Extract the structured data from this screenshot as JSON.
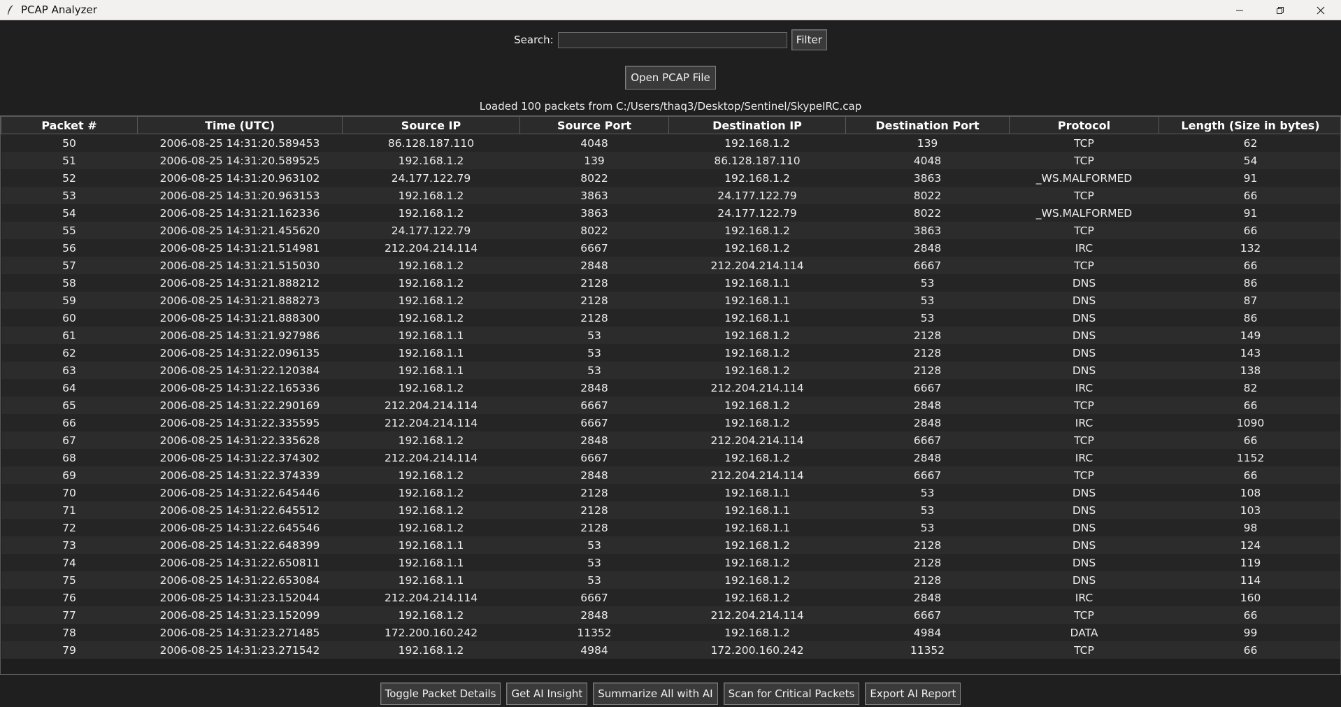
{
  "window": {
    "title": "PCAP Analyzer",
    "icon": "feather-icon"
  },
  "search": {
    "label": "Search:",
    "value": "",
    "placeholder": "",
    "filter_label": "Filter"
  },
  "open_button_label": "Open PCAP File",
  "status": "Loaded 100 packets from C:/Users/thaq3/Desktop/Sentinel/SkypeIRC.cap",
  "table": {
    "columns": [
      "Packet #",
      "Time (UTC)",
      "Source IP",
      "Source Port",
      "Destination IP",
      "Destination Port",
      "Protocol",
      "Length (Size in bytes)"
    ],
    "rows": [
      [
        "50",
        "2006-08-25 14:31:20.589453",
        "86.128.187.110",
        "4048",
        "192.168.1.2",
        "139",
        "TCP",
        "62"
      ],
      [
        "51",
        "2006-08-25 14:31:20.589525",
        "192.168.1.2",
        "139",
        "86.128.187.110",
        "4048",
        "TCP",
        "54"
      ],
      [
        "52",
        "2006-08-25 14:31:20.963102",
        "24.177.122.79",
        "8022",
        "192.168.1.2",
        "3863",
        "_WS.MALFORMED",
        "91"
      ],
      [
        "53",
        "2006-08-25 14:31:20.963153",
        "192.168.1.2",
        "3863",
        "24.177.122.79",
        "8022",
        "TCP",
        "66"
      ],
      [
        "54",
        "2006-08-25 14:31:21.162336",
        "192.168.1.2",
        "3863",
        "24.177.122.79",
        "8022",
        "_WS.MALFORMED",
        "91"
      ],
      [
        "55",
        "2006-08-25 14:31:21.455620",
        "24.177.122.79",
        "8022",
        "192.168.1.2",
        "3863",
        "TCP",
        "66"
      ],
      [
        "56",
        "2006-08-25 14:31:21.514981",
        "212.204.214.114",
        "6667",
        "192.168.1.2",
        "2848",
        "IRC",
        "132"
      ],
      [
        "57",
        "2006-08-25 14:31:21.515030",
        "192.168.1.2",
        "2848",
        "212.204.214.114",
        "6667",
        "TCP",
        "66"
      ],
      [
        "58",
        "2006-08-25 14:31:21.888212",
        "192.168.1.2",
        "2128",
        "192.168.1.1",
        "53",
        "DNS",
        "86"
      ],
      [
        "59",
        "2006-08-25 14:31:21.888273",
        "192.168.1.2",
        "2128",
        "192.168.1.1",
        "53",
        "DNS",
        "87"
      ],
      [
        "60",
        "2006-08-25 14:31:21.888300",
        "192.168.1.2",
        "2128",
        "192.168.1.1",
        "53",
        "DNS",
        "86"
      ],
      [
        "61",
        "2006-08-25 14:31:21.927986",
        "192.168.1.1",
        "53",
        "192.168.1.2",
        "2128",
        "DNS",
        "149"
      ],
      [
        "62",
        "2006-08-25 14:31:22.096135",
        "192.168.1.1",
        "53",
        "192.168.1.2",
        "2128",
        "DNS",
        "143"
      ],
      [
        "63",
        "2006-08-25 14:31:22.120384",
        "192.168.1.1",
        "53",
        "192.168.1.2",
        "2128",
        "DNS",
        "138"
      ],
      [
        "64",
        "2006-08-25 14:31:22.165336",
        "192.168.1.2",
        "2848",
        "212.204.214.114",
        "6667",
        "IRC",
        "82"
      ],
      [
        "65",
        "2006-08-25 14:31:22.290169",
        "212.204.214.114",
        "6667",
        "192.168.1.2",
        "2848",
        "TCP",
        "66"
      ],
      [
        "66",
        "2006-08-25 14:31:22.335595",
        "212.204.214.114",
        "6667",
        "192.168.1.2",
        "2848",
        "IRC",
        "1090"
      ],
      [
        "67",
        "2006-08-25 14:31:22.335628",
        "192.168.1.2",
        "2848",
        "212.204.214.114",
        "6667",
        "TCP",
        "66"
      ],
      [
        "68",
        "2006-08-25 14:31:22.374302",
        "212.204.214.114",
        "6667",
        "192.168.1.2",
        "2848",
        "IRC",
        "1152"
      ],
      [
        "69",
        "2006-08-25 14:31:22.374339",
        "192.168.1.2",
        "2848",
        "212.204.214.114",
        "6667",
        "TCP",
        "66"
      ],
      [
        "70",
        "2006-08-25 14:31:22.645446",
        "192.168.1.2",
        "2128",
        "192.168.1.1",
        "53",
        "DNS",
        "108"
      ],
      [
        "71",
        "2006-08-25 14:31:22.645512",
        "192.168.1.2",
        "2128",
        "192.168.1.1",
        "53",
        "DNS",
        "103"
      ],
      [
        "72",
        "2006-08-25 14:31:22.645546",
        "192.168.1.2",
        "2128",
        "192.168.1.1",
        "53",
        "DNS",
        "98"
      ],
      [
        "73",
        "2006-08-25 14:31:22.648399",
        "192.168.1.1",
        "53",
        "192.168.1.2",
        "2128",
        "DNS",
        "124"
      ],
      [
        "74",
        "2006-08-25 14:31:22.650811",
        "192.168.1.1",
        "53",
        "192.168.1.2",
        "2128",
        "DNS",
        "119"
      ],
      [
        "75",
        "2006-08-25 14:31:22.653084",
        "192.168.1.1",
        "53",
        "192.168.1.2",
        "2128",
        "DNS",
        "114"
      ],
      [
        "76",
        "2006-08-25 14:31:23.152044",
        "212.204.214.114",
        "6667",
        "192.168.1.2",
        "2848",
        "IRC",
        "160"
      ],
      [
        "77",
        "2006-08-25 14:31:23.152099",
        "192.168.1.2",
        "2848",
        "212.204.214.114",
        "6667",
        "TCP",
        "66"
      ],
      [
        "78",
        "2006-08-25 14:31:23.271485",
        "172.200.160.242",
        "11352",
        "192.168.1.2",
        "4984",
        "DATA",
        "99"
      ],
      [
        "79",
        "2006-08-25 14:31:23.271542",
        "192.168.1.2",
        "4984",
        "172.200.160.242",
        "11352",
        "TCP",
        "66"
      ]
    ]
  },
  "actions": [
    {
      "name": "toggle-packet-details-button",
      "label": "Toggle Packet Details"
    },
    {
      "name": "get-ai-insight-button",
      "label": "Get AI Insight"
    },
    {
      "name": "summarize-all-with-ai-button",
      "label": "Summarize All with AI"
    },
    {
      "name": "scan-for-critical-packets-button",
      "label": "Scan for Critical Packets"
    },
    {
      "name": "export-ai-report-button",
      "label": "Export AI Report"
    }
  ],
  "colors": {
    "background": "#1f1f1f",
    "titlebar": "#f3f0f0",
    "row_odd": "#252525",
    "row_even": "#2c2c2c",
    "button": "#3a3a3a"
  }
}
